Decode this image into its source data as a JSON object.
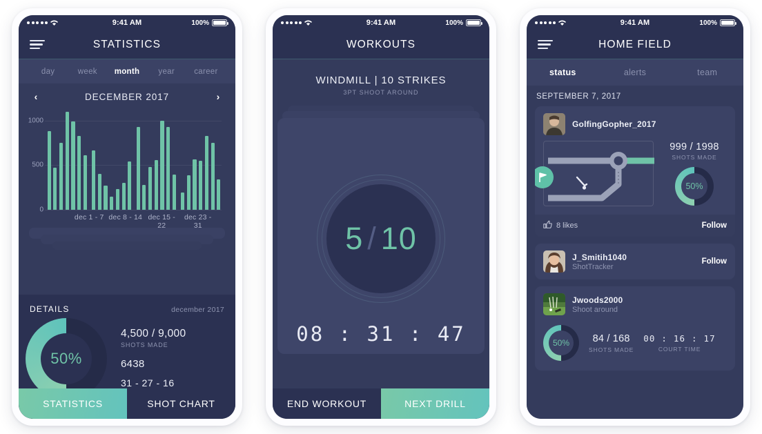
{
  "statusbar": {
    "time": "9:41 AM",
    "battery": "100%",
    "signal_dots": 5
  },
  "screen1": {
    "nav_title": "STATISTICS",
    "segments": [
      {
        "label": "day",
        "active": false
      },
      {
        "label": "week",
        "active": false
      },
      {
        "label": "month",
        "active": true
      },
      {
        "label": "year",
        "active": false
      },
      {
        "label": "career",
        "active": false
      }
    ],
    "month_label": "DECEMBER 2017",
    "prev_arrow": "‹",
    "next_arrow": "›",
    "details": {
      "title": "DETAILS",
      "period": "december 2017",
      "percent": "50%",
      "percent_value": 50,
      "shots": "4,500 / 9,000",
      "shots_label": "SHOTS MADE",
      "points": "6438",
      "record": "31 - 27 - 16"
    },
    "bottom": {
      "left": "STATISTICS",
      "right": "SHOT CHART"
    }
  },
  "screen2": {
    "nav_title": "WORKOUTS",
    "drill_title": "WINDMILL  |  10 STRIKES",
    "drill_sub": "3PT SHOOT AROUND",
    "made": "5",
    "separator": "/",
    "target": "10",
    "timer": "08 : 31 : 47",
    "bottom": {
      "left": "END WORKOUT",
      "right": "NEXT DRILL"
    }
  },
  "screen3": {
    "nav_title": "HOME FIELD",
    "tabs": [
      {
        "label": "status",
        "active": true
      },
      {
        "label": "alerts",
        "active": false
      },
      {
        "label": "team",
        "active": false
      }
    ],
    "date_header": "SEPTEMBER 7, 2017",
    "posts": [
      {
        "user": "GolfingGopher_2017",
        "shots": "999 / 1998",
        "shots_label": "SHOTS MADE",
        "percent": "50%",
        "percent_value": 50,
        "likes": "8 likes",
        "follow": "Follow"
      },
      {
        "user": "J_Smitih1040",
        "sub": "ShotTracker",
        "follow": "Follow"
      },
      {
        "user": "Jwoods2000",
        "sub": "Shoot around",
        "percent": "50%",
        "percent_value": 50,
        "shots": "84 / 168",
        "shots_label": "SHOTS MADE",
        "court_time": "00 : 16 : 17",
        "court_label": "COURT TIME"
      }
    ]
  },
  "colors": {
    "accent": "#6fc3a7",
    "accent_alt": "#63c3bd",
    "screen_bg": "#343b5c",
    "nav_bg": "#2b3152",
    "card_bg": "#3b4265",
    "track": "#252b48",
    "muted_text": "#8e94b0"
  },
  "chart_data": {
    "type": "bar",
    "title": "DECEMBER 2017",
    "xlabel": "",
    "ylabel": "",
    "ylim": [
      0,
      1100
    ],
    "yticks": [
      0,
      500,
      1000
    ],
    "ytick_labels": [
      "0",
      "500",
      "1000"
    ],
    "grid": true,
    "legend": false,
    "categories": [
      "dec 1 - 7",
      "dec 8 - 14",
      "dec 15 - 22",
      "dec 23 - 31"
    ],
    "groups": [
      {
        "label": "dec 1 - 7",
        "values": [
          880,
          475,
          750,
          1100,
          990,
          830,
          610
        ]
      },
      {
        "label": "dec 8 - 14",
        "values": [
          665,
          400,
          275,
          145,
          230,
          300,
          545
        ]
      },
      {
        "label": "dec 15 - 22",
        "values": [
          930,
          280,
          480,
          555,
          1000,
          930,
          395
        ]
      },
      {
        "label": "dec 23 - 31",
        "values": [
          195,
          390,
          565,
          550,
          830,
          750,
          340
        ]
      }
    ],
    "bar_color": "#6fc3a7"
  }
}
